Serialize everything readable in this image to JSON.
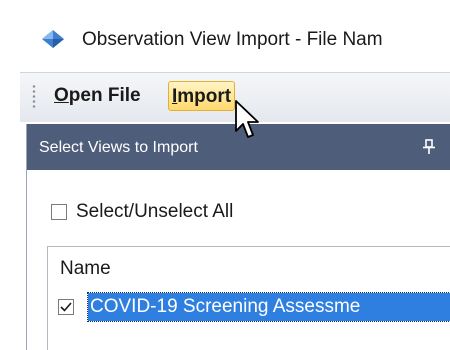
{
  "window": {
    "title": "Observation View Import - File Nam"
  },
  "toolbar": {
    "open_file": {
      "accel": "O",
      "rest": "pen File"
    },
    "import": {
      "accel": "I",
      "rest": "mport"
    }
  },
  "panel": {
    "title": "Select Views to Import",
    "select_all": {
      "label": "Select/Unselect All",
      "checked": false
    },
    "list": {
      "column_header": "Name",
      "items": [
        {
          "label": "COVID-19 Screening Assessme",
          "checked": true,
          "selected": true
        }
      ]
    }
  },
  "colors": {
    "header": "#4e5e7a",
    "selection": "#2f7fe0",
    "hover": "#ffd96b"
  },
  "icons": {
    "app": "app-icon",
    "pin": "pin-icon",
    "cursor": "mouse-pointer-icon"
  }
}
